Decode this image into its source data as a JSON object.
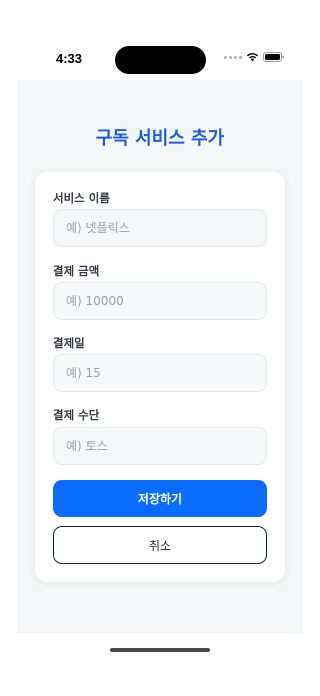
{
  "status_bar": {
    "time": "4:33",
    "signal_icon": "cellular-signal-dots",
    "wifi_icon": "wifi-icon",
    "battery_icon": "battery-icon"
  },
  "page": {
    "title": "구독 서비스 추가",
    "title_color": "#1a5fd6",
    "background_color": "#f5f6f8"
  },
  "form": {
    "fields": [
      {
        "label": "서비스 이름",
        "placeholder": "예) 넷플릭스",
        "value": ""
      },
      {
        "label": "결제 금액",
        "placeholder": "예) 10000",
        "value": ""
      },
      {
        "label": "결제일",
        "placeholder": "예) 15",
        "value": ""
      },
      {
        "label": "결제 수단",
        "placeholder": "예) 토스",
        "value": ""
      }
    ],
    "save_label": "저장하기",
    "cancel_label": "취소",
    "accent_color": "#0a6cff"
  }
}
